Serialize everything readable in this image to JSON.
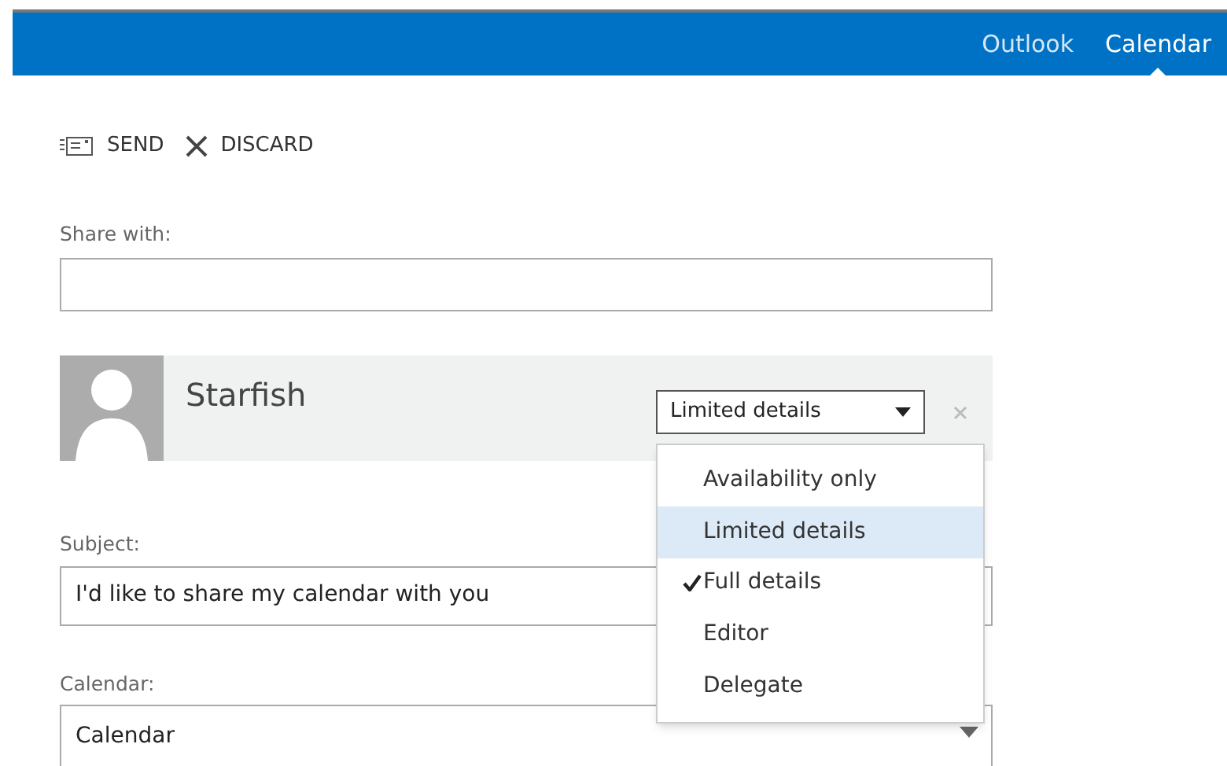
{
  "nav": [
    {
      "label": "Outlook",
      "selected": false
    },
    {
      "label": "Calendar",
      "selected": true
    }
  ],
  "toolbar": [
    {
      "kind": "send",
      "label": "SEND"
    },
    {
      "kind": "discard",
      "label": "DISCARD"
    }
  ],
  "share_with": {
    "label": "Share with:"
  },
  "recipient": {
    "name": "Starfish",
    "permission": "Limited details",
    "menu": [
      {
        "label": "Availability only",
        "highlighted": false,
        "selected": false
      },
      {
        "label": "Limited details",
        "highlighted": true,
        "selected": false
      },
      {
        "label": "Full details",
        "highlighted": false,
        "selected": true
      },
      {
        "label": "Editor",
        "highlighted": false,
        "selected": false
      },
      {
        "label": "Delegate",
        "highlighted": false,
        "selected": false
      }
    ]
  },
  "subject": {
    "label": "Subject:",
    "value": "I'd like to share my calendar with you"
  },
  "calendar": {
    "label": "Calendar:",
    "value": "Calendar"
  }
}
